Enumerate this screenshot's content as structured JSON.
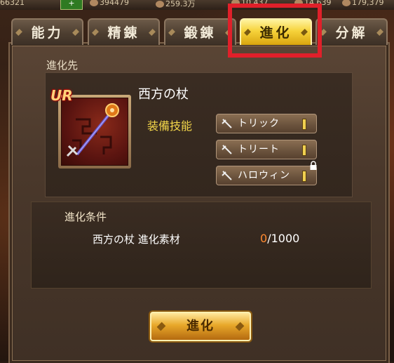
{
  "topbar": {
    "items": [
      "66321",
      "394479",
      "259.3万",
      "10,437",
      "14,639",
      "179,379"
    ]
  },
  "tabs": [
    {
      "label": "能力",
      "active": false
    },
    {
      "label": "精錬",
      "active": false
    },
    {
      "label": "鍛錬",
      "active": false
    },
    {
      "label": "進化",
      "active": true
    },
    {
      "label": "分解",
      "active": false
    }
  ],
  "evolution_target": {
    "section_label": "進化先",
    "rarity": "UR",
    "item_name": "西方の杖",
    "equip_skill_label": "装備技能",
    "skills": [
      {
        "label": "トリック",
        "locked": false
      },
      {
        "label": "トリート",
        "locked": false
      },
      {
        "label": "ハロウィン",
        "locked": true
      }
    ]
  },
  "conditions": {
    "section_label": "進化条件",
    "material_label": "西方の杖 進化素材",
    "current": "0",
    "required": "/1000"
  },
  "evolve_button": {
    "label": "進化"
  },
  "colors": {
    "active_tab": "#f6d23a",
    "highlight_box": "#e0202a",
    "count_current": "#ff8a30",
    "equip_label": "#f3d64a"
  }
}
